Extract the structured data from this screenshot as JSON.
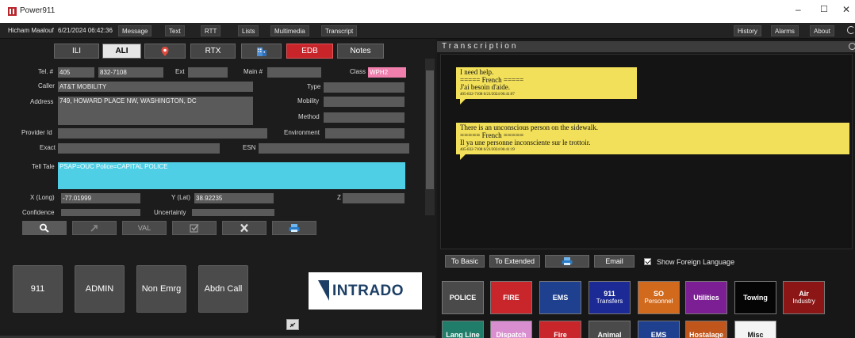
{
  "window": {
    "title": "Power911",
    "controls": [
      "–",
      "☐",
      "✕"
    ]
  },
  "menubar": {
    "user": "Hicham Maalouf",
    "datetime": "6/21/2024 06:42:36",
    "left_items": [
      "Message",
      "Text",
      "RTT",
      "Lists",
      "Multimedia",
      "Transcript"
    ],
    "right_items": [
      "History",
      "Alarms",
      "About"
    ]
  },
  "tabs": [
    "ILI",
    "ALI",
    "",
    "RTX",
    "",
    "EDB",
    "Notes"
  ],
  "active_tab": "ALI",
  "ali": {
    "tel_label": "Tel. #",
    "tel_area": "405",
    "tel_number": "832-7108",
    "ext_label": "Ext",
    "ext_value": "",
    "main_label": "Main #",
    "main_value": "",
    "class_label": "Class",
    "class_value": "WPH2",
    "caller_label": "Caller",
    "caller_value": "AT&T MOBILITY",
    "type_label": "Type",
    "type_value": "",
    "address_label": "Address",
    "address_value": "749, HOWARD PLACE NW, WASHINGTON, DC",
    "mobility_label": "Mobility",
    "mobility_value": "",
    "method_label": "Method",
    "method_value": "",
    "provider_label": "Provider Id",
    "provider_value": "",
    "environment_label": "Environment",
    "environment_value": "",
    "exact_label": "Exact",
    "exact_value": "",
    "esn_label": "ESN",
    "esn_value": "",
    "telltale_label": "Tell Tale",
    "telltale_value": "PSAP=OUC Police=CAPITAL POLICE",
    "long_label": "X (Long)",
    "long_value": "-77.01999",
    "lat_label": "Y (Lat)",
    "lat_value": "38.92235",
    "z_label": "Z",
    "z_value": "",
    "confidence_label": "Confidence",
    "confidence_value": "",
    "uncertainty_label": "Uncertainty",
    "uncertainty_value": ""
  },
  "tools": {
    "val_label": "VAL"
  },
  "call_buttons": [
    "911",
    "ADMIN",
    "Non Emrg",
    "Abdn Call"
  ],
  "logo_text": "INTRADO",
  "transcription": {
    "header": "Transcription",
    "messages": [
      {
        "lines": [
          "I need help.",
          "===== French =====",
          "J'ai besoin d'aide."
        ],
        "meta": "405-832-7108 6/21/2024 06:41:07"
      },
      {
        "lines": [
          "There is an unconscious person on the sidewalk.",
          "===== French =====",
          "Il ya une personne inconsciente sur le trottoir."
        ],
        "meta": "405-832-7108 6/21/2024 06:41:19"
      }
    ],
    "to_basic": "To Basic",
    "to_extended": "To Extended",
    "email": "Email",
    "show_foreign_label": "Show Foreign Language",
    "show_foreign_checked": true
  },
  "agencies_row1": [
    {
      "label": "POLICE",
      "sub": "",
      "color": "#4a4a4a"
    },
    {
      "label": "FIRE",
      "sub": "",
      "color": "#c9262c"
    },
    {
      "label": "EMS",
      "sub": "",
      "color": "#1f3f8f"
    },
    {
      "label": "911",
      "sub": "Transfers",
      "color": "#1c2a95"
    },
    {
      "label": "SO",
      "sub": "Personnel",
      "color": "#d26a1e"
    },
    {
      "label": "Utilities",
      "sub": "",
      "color": "#7c1f94"
    },
    {
      "label": "Towing",
      "sub": "",
      "color": "#050505"
    },
    {
      "label": "Air",
      "sub": "Industry",
      "color": "#8c1616"
    }
  ],
  "agencies_row2": [
    {
      "label": "Lang Line",
      "color": "#1f7d6a"
    },
    {
      "label": "Dispatch",
      "color": "#d98ed0"
    },
    {
      "label": "Fire",
      "color": "#c9262c"
    },
    {
      "label": "Animal",
      "color": "#4a4a4a"
    },
    {
      "label": "EMS",
      "color": "#1f3f8f"
    },
    {
      "label": "Hostalage",
      "color": "#c0561c"
    },
    {
      "label": "Misc",
      "color": "#f4f4f4"
    }
  ]
}
